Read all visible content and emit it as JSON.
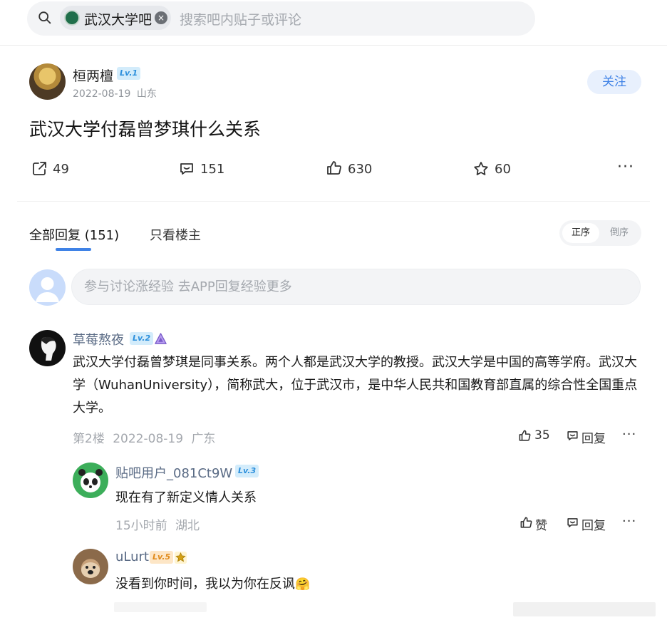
{
  "search": {
    "forum_name": "武汉大学吧",
    "placeholder": "搜索吧内贴子或评论",
    "clear_glyph": "×"
  },
  "post": {
    "author": "桓两檀",
    "author_level": "Lv.1",
    "date": "2022-08-19",
    "location": "山东",
    "follow_label": "关注",
    "title": "武汉大学付磊曾梦琪什么关系",
    "actions": {
      "share_count": "49",
      "comment_count": "151",
      "like_count": "630",
      "favorite_count": "60",
      "more_glyph": "···"
    }
  },
  "tabs": {
    "all_replies": "全部回复 (151)",
    "op_only": "只看楼主",
    "sort_asc": "正序",
    "sort_desc": "倒序",
    "active": "all_replies",
    "active_sort": "sort_asc"
  },
  "reply_box": {
    "placeholder": "参与讨论涨经验 去APP回复经验更多"
  },
  "comments": [
    {
      "author": "草莓熬夜",
      "level": "Lv.2",
      "text": "武汉大学付磊曾梦琪是同事关系。两个人都是武汉大学的教授。武汉大学是中国的高等学府。武汉大学（WuhanUniversity），简称武大，位于武汉市，是中华人民共和国教育部直属的综合性全国重点大学。",
      "floor": "第2楼",
      "date": "2022-08-19",
      "location": "广东",
      "like_count": "35",
      "reply_label": "回复",
      "more_glyph": "···",
      "replies": [
        {
          "author": "贴吧用户_081Ct9W",
          "level": "Lv.3",
          "text": "现在有了新定义情人关系",
          "time": "15小时前",
          "location": "湖北",
          "like_label": "赞",
          "reply_label": "回复",
          "more_glyph": "···"
        },
        {
          "author": "uLurt",
          "level": "Lv.5",
          "text": "没看到你时间，我以为你在反讽",
          "emoji": "🤗"
        }
      ]
    }
  ],
  "colors": {
    "accent": "#3f82e6",
    "username": "#5a6b85",
    "meta": "#a4a8ae"
  }
}
